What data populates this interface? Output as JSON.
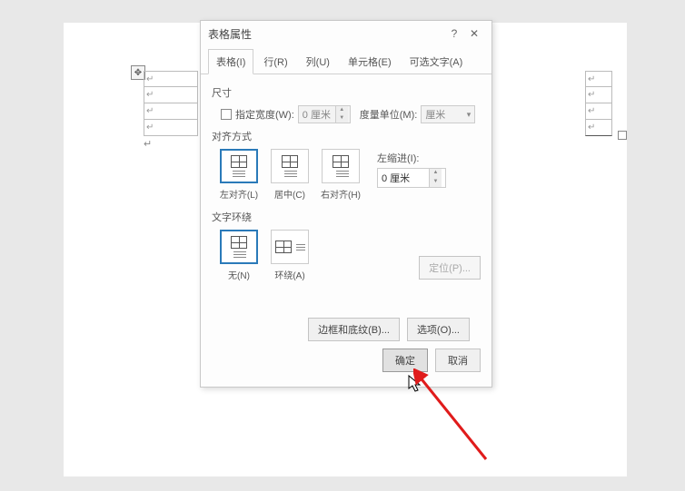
{
  "dialog": {
    "title": "表格属性",
    "tabs": {
      "table": "表格(I)",
      "row": "行(R)",
      "column": "列(U)",
      "cell": "单元格(E)",
      "alttext": "可选文字(A)"
    },
    "size": {
      "label": "尺寸",
      "width_chk": "指定宽度(W):",
      "width_value": "0 厘米",
      "unit_label": "度量单位(M):",
      "unit_value": "厘米"
    },
    "align": {
      "label": "对齐方式",
      "left": "左对齐(L)",
      "center": "居中(C)",
      "right": "右对齐(H)",
      "indent_label": "左缩进(I):",
      "indent_value": "0 厘米"
    },
    "wrap": {
      "label": "文字环绕",
      "none": "无(N)",
      "around": "环绕(A)",
      "position": "定位(P)..."
    },
    "buttons": {
      "borders": "边框和底纹(B)...",
      "options": "选项(O)...",
      "ok": "确定",
      "cancel": "取消"
    }
  }
}
